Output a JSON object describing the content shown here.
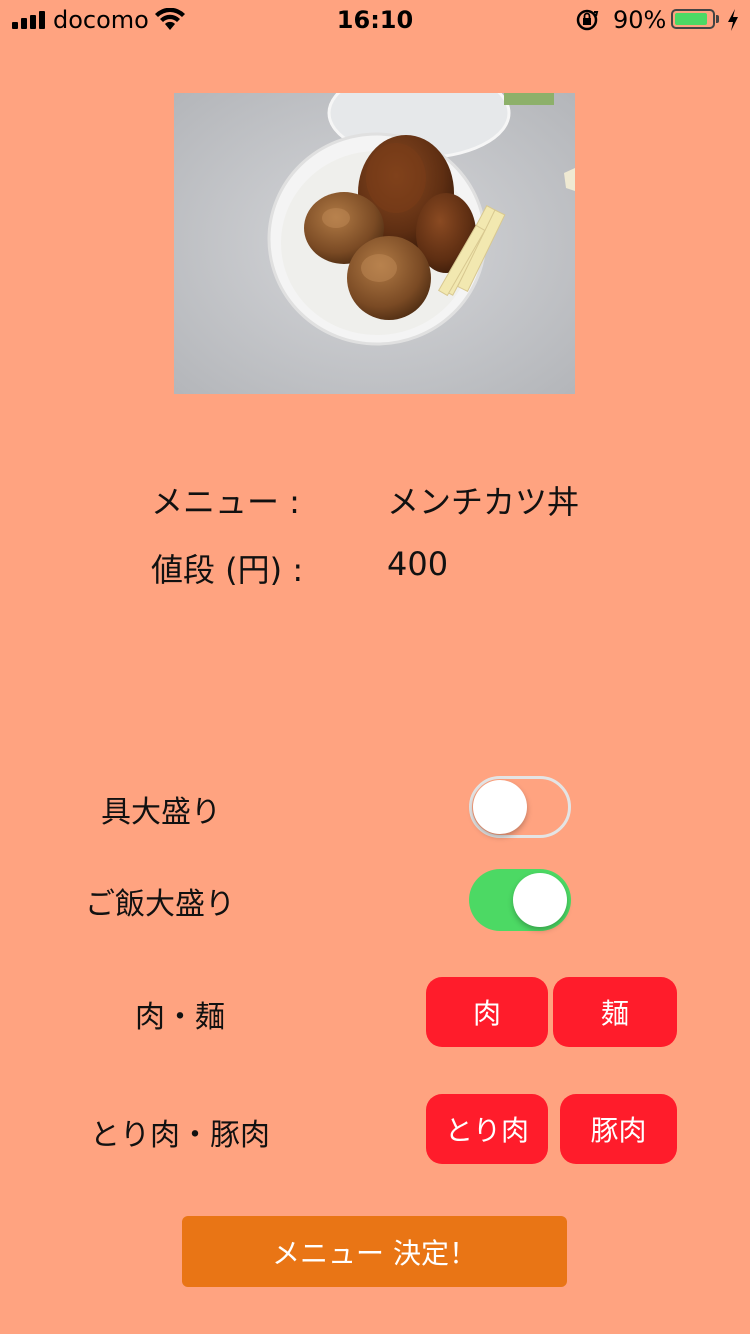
{
  "status_bar": {
    "carrier": "docomo",
    "time": "16:10",
    "battery_percent": "90%",
    "battery_level": 0.9,
    "signal_bars": 4,
    "icons": [
      "signal-icon",
      "wifi-icon",
      "orientation-lock-icon",
      "battery-icon",
      "charging-bolt-icon"
    ]
  },
  "photo": {
    "subject": "menchi-katsu-don-photo"
  },
  "info": {
    "menu_label": "メニュー :",
    "menu_value": "メンチカツ丼",
    "price_label": "値段 (円) :",
    "price_value": "400"
  },
  "options": {
    "extra_topping_label": "具大盛り",
    "extra_topping_on": false,
    "extra_rice_label": "ご飯大盛り",
    "extra_rice_on": true,
    "meat_noodle_label": "肉・麺",
    "meat_button": "肉",
    "noodle_button": "麺",
    "chicken_pork_label": "とり肉・豚肉",
    "chicken_button": "とり肉",
    "pork_button": "豚肉"
  },
  "submit": {
    "label": "メニュー 決定！"
  },
  "colors": {
    "background": "#FFA380",
    "switch_on": "#4CD964",
    "choice_button": "#FF1C2B",
    "submit_button": "#E97515"
  }
}
